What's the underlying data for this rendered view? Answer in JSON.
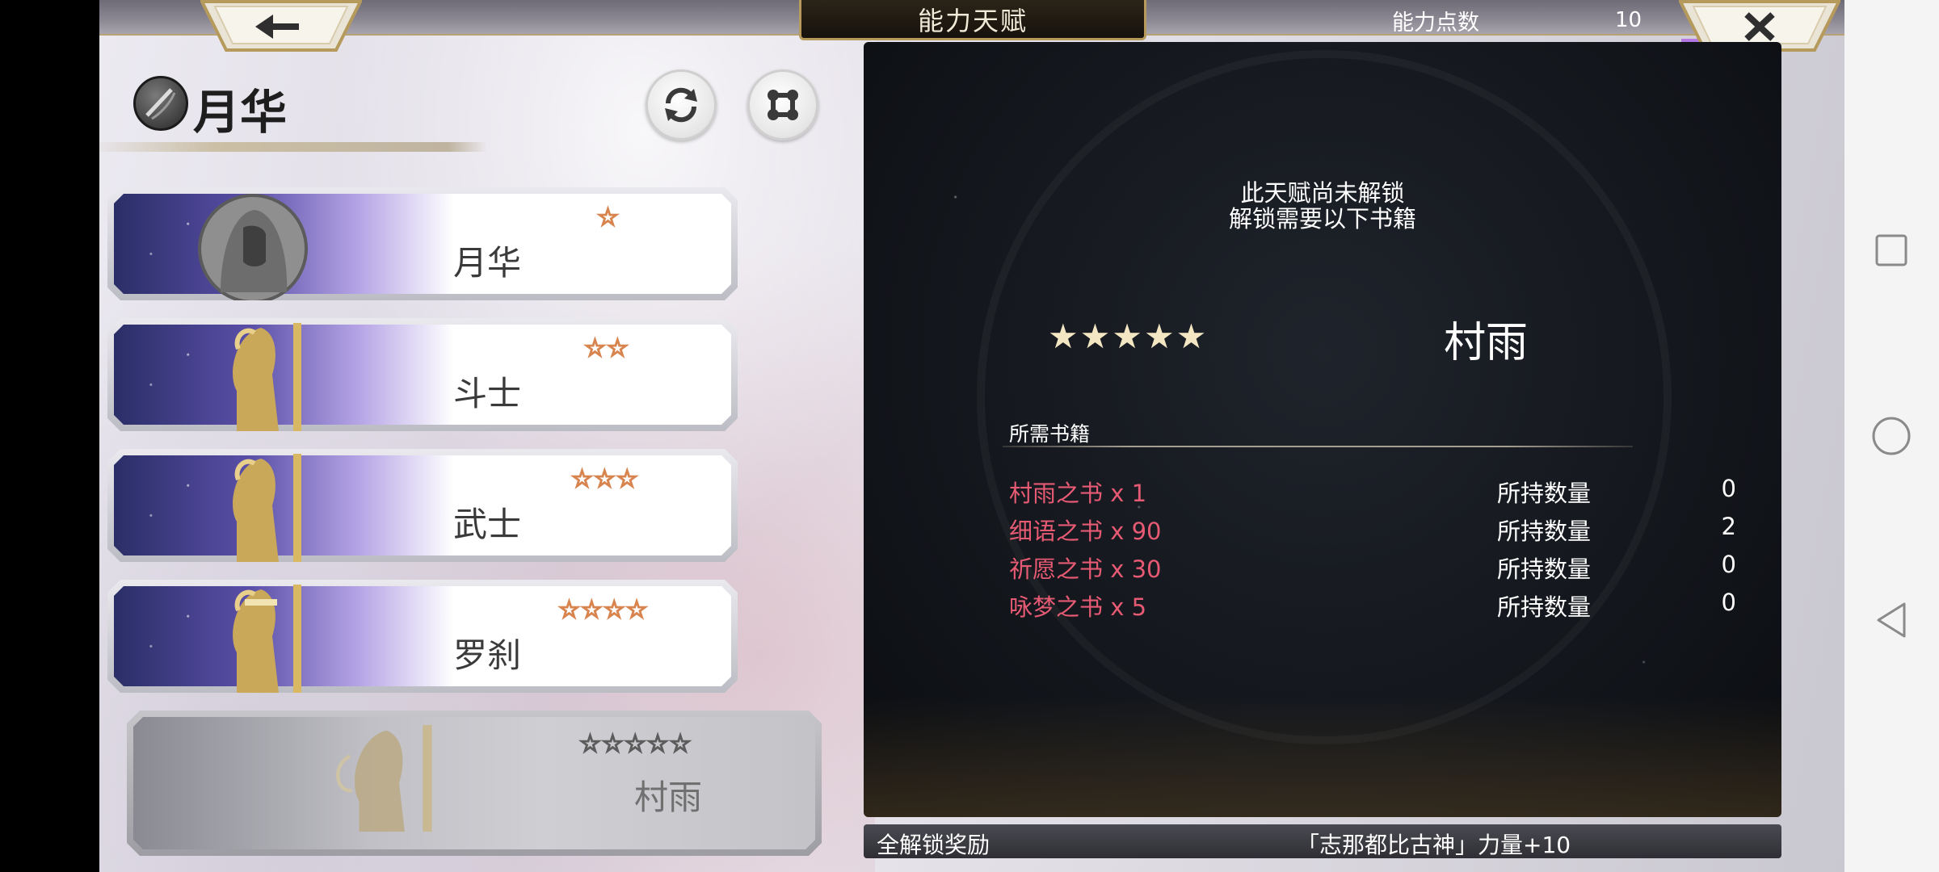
{
  "header": {
    "title": "能力天赋",
    "points_label": "能力点数",
    "points_value": "10"
  },
  "character": {
    "name": "月华"
  },
  "classes": [
    {
      "stars": "☆",
      "label": "月华",
      "locked": false
    },
    {
      "stars": "☆☆",
      "label": "斗士",
      "locked": false
    },
    {
      "stars": "☆☆☆",
      "label": "武士",
      "locked": false
    },
    {
      "stars": "☆☆☆☆",
      "label": "罗刹",
      "locked": false
    },
    {
      "stars": "☆☆☆☆☆",
      "label": "村雨",
      "locked": true
    }
  ],
  "detail": {
    "lock_line1": "此天赋尚未解锁",
    "lock_line2": "解锁需要以下书籍",
    "stars": "★★★★★",
    "skill_name": "村雨",
    "req_title": "所需书籍",
    "requirements": [
      {
        "book": "村雨之书 x 1",
        "owned_label": "所持数量",
        "owned": "0"
      },
      {
        "book": "细语之书 x 90",
        "owned_label": "所持数量",
        "owned": "2"
      },
      {
        "book": "祈愿之书 x 30",
        "owned_label": "所持数量",
        "owned": "0"
      },
      {
        "book": "咏梦之书 x 5",
        "owned_label": "所持数量",
        "owned": "0"
      }
    ]
  },
  "footer": {
    "left": "全解锁奖励",
    "right": "「志那都比古神」力量+10"
  },
  "colors": {
    "book_text": "#e65a73",
    "gold_border": "#b59a5c",
    "panel_bg": "#111419"
  },
  "icons": {
    "back": "arrow-left-icon",
    "close": "close-icon",
    "swap": "refresh-icon",
    "skill_tree": "skill-tree-icon",
    "nav_recent": "square-icon",
    "nav_home": "circle-icon",
    "nav_back": "triangle-back-icon"
  }
}
